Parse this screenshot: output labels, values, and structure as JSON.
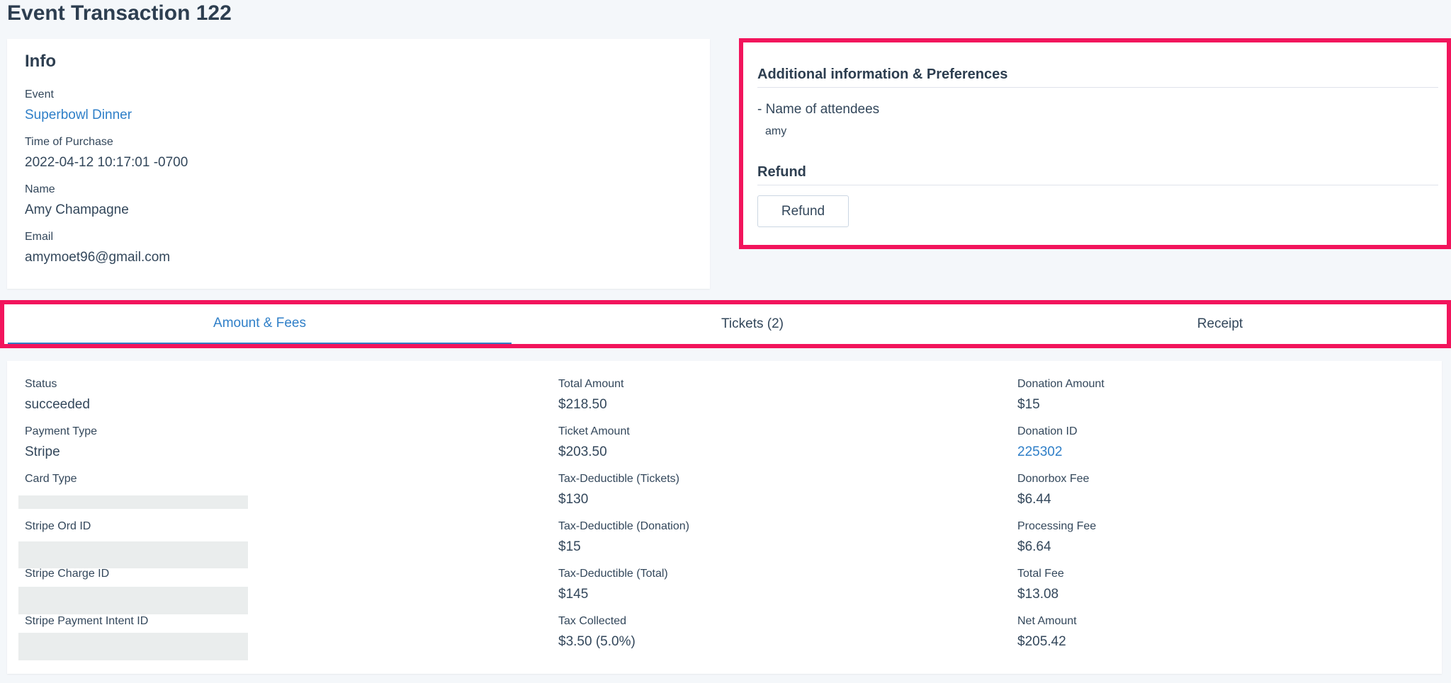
{
  "page": {
    "title": "Event Transaction 122"
  },
  "info": {
    "heading": "Info",
    "fields": [
      {
        "label": "Event",
        "value": "Superbowl Dinner"
      },
      {
        "label": "Time of Purchase",
        "value": "2022-04-12 10:17:01 -0700"
      },
      {
        "label": "Name",
        "value": "Amy Champagne"
      },
      {
        "label": "Email",
        "value": "amymoet96@gmail.com"
      }
    ]
  },
  "preferences": {
    "heading": "Additional information & Preferences",
    "question": "- Name of attendees",
    "answer": "amy",
    "refund_heading": "Refund",
    "refund_button": "Refund"
  },
  "tabs": [
    {
      "label": "Amount & Fees",
      "active": true
    },
    {
      "label": "Tickets (2)",
      "active": false
    },
    {
      "label": "Receipt",
      "active": false
    }
  ],
  "fees": {
    "col1": [
      {
        "label": "Status",
        "value": "succeeded"
      },
      {
        "label": "Payment Type",
        "value": "Stripe"
      },
      {
        "label": "Card Type",
        "value": ""
      },
      {
        "label": "Stripe Ord ID",
        "value": ""
      },
      {
        "label": "Stripe Charge ID",
        "value": ""
      },
      {
        "label": "Stripe Payment Intent ID",
        "value": ""
      }
    ],
    "col2": [
      {
        "label": "Total Amount",
        "value": "$218.50"
      },
      {
        "label": "Ticket Amount",
        "value": "$203.50"
      },
      {
        "label": "Tax-Deductible (Tickets)",
        "value": "$130"
      },
      {
        "label": "Tax-Deductible (Donation)",
        "value": "$15"
      },
      {
        "label": "Tax-Deductible (Total)",
        "value": "$145"
      },
      {
        "label": "Tax Collected",
        "value": "$3.50 (5.0%)"
      }
    ],
    "col3": [
      {
        "label": "Donation Amount",
        "value": "$15"
      },
      {
        "label": "Donation ID",
        "value": "225302"
      },
      {
        "label": "Donorbox Fee",
        "value": "$6.44"
      },
      {
        "label": "Processing Fee",
        "value": "$6.64"
      },
      {
        "label": "Total Fee",
        "value": "$13.08"
      },
      {
        "label": "Net Amount",
        "value": "$205.42"
      }
    ]
  },
  "colors": {
    "accent": "#2f7fc8",
    "highlight": "#f2145c",
    "text": "#33475b"
  }
}
